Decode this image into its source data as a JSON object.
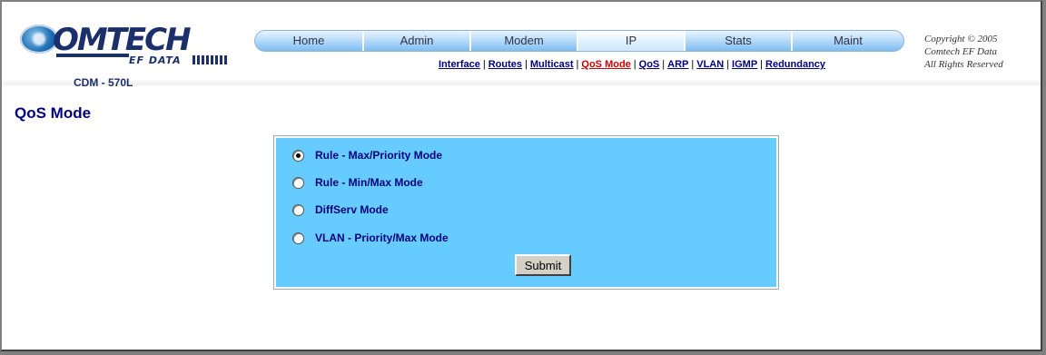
{
  "brand": {
    "logo_text": "OMTECH",
    "logo_sub": "EF DATA",
    "model": "CDM - 570L"
  },
  "nav": {
    "tabs": [
      {
        "label": "Home"
      },
      {
        "label": "Admin"
      },
      {
        "label": "Modem"
      },
      {
        "label": "IP",
        "active": true
      },
      {
        "label": "Stats"
      },
      {
        "label": "Maint"
      }
    ]
  },
  "subnav": {
    "links": [
      {
        "label": "Interface"
      },
      {
        "label": "Routes"
      },
      {
        "label": "Multicast"
      },
      {
        "label": "QoS Mode",
        "current": true
      },
      {
        "label": "QoS"
      },
      {
        "label": "ARP"
      },
      {
        "label": "VLAN"
      },
      {
        "label": "IGMP"
      },
      {
        "label": "Redundancy"
      }
    ],
    "separator": "|"
  },
  "copyright": {
    "line1": "Copyright © 2005",
    "line2": "Comtech EF Data",
    "line3": "All Rights Reserved"
  },
  "page": {
    "title": "QoS Mode"
  },
  "qos_form": {
    "options": [
      {
        "label": "Rule - Max/Priority Mode",
        "checked": true
      },
      {
        "label": "Rule - Min/Max Mode",
        "checked": false
      },
      {
        "label": "DiffServ Mode",
        "checked": false
      },
      {
        "label": "VLAN - Priority/Max Mode",
        "checked": false
      }
    ],
    "submit_label": "Submit"
  },
  "colors": {
    "panel": "#66ccff",
    "link": "#00007f",
    "active_link": "#cc0000",
    "brand": "#1b2f6b"
  }
}
